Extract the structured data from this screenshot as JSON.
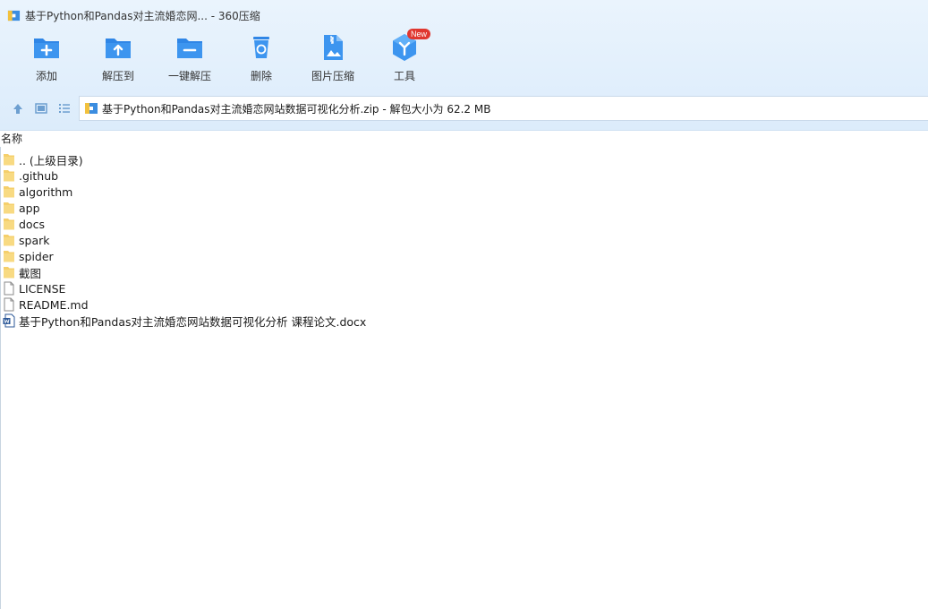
{
  "window": {
    "title": "基于Python和Pandas对主流婚恋网... - 360压缩"
  },
  "toolbar": {
    "items": [
      {
        "label": "添加",
        "icon": "add-folder-icon"
      },
      {
        "label": "解压到",
        "icon": "extract-to-icon"
      },
      {
        "label": "一键解压",
        "icon": "one-click-extract-icon"
      },
      {
        "label": "删除",
        "icon": "delete-icon"
      },
      {
        "label": "图片压缩",
        "icon": "image-compress-icon"
      },
      {
        "label": "工具",
        "icon": "tools-icon",
        "badge": "New"
      }
    ]
  },
  "nav": {
    "address": "基于Python和Pandas对主流婚恋网站数据可视化分析.zip - 解包大小为 62.2 MB"
  },
  "list": {
    "header": "名称",
    "items": [
      {
        "name": ".. (上级目录)",
        "type": "folder"
      },
      {
        "name": ".github",
        "type": "folder"
      },
      {
        "name": "algorithm",
        "type": "folder"
      },
      {
        "name": "app",
        "type": "folder"
      },
      {
        "name": "docs",
        "type": "folder"
      },
      {
        "name": "spark",
        "type": "folder"
      },
      {
        "name": "spider",
        "type": "folder"
      },
      {
        "name": "截图",
        "type": "folder"
      },
      {
        "name": "LICENSE",
        "type": "file"
      },
      {
        "name": "README.md",
        "type": "file"
      },
      {
        "name": "基于Python和Pandas对主流婚恋网站数据可视化分析 课程论文.docx",
        "type": "word"
      }
    ]
  },
  "colors": {
    "accent": "#1e88e5",
    "toolbar_bg": "#e3effb",
    "folder": "#f5cf6b"
  }
}
